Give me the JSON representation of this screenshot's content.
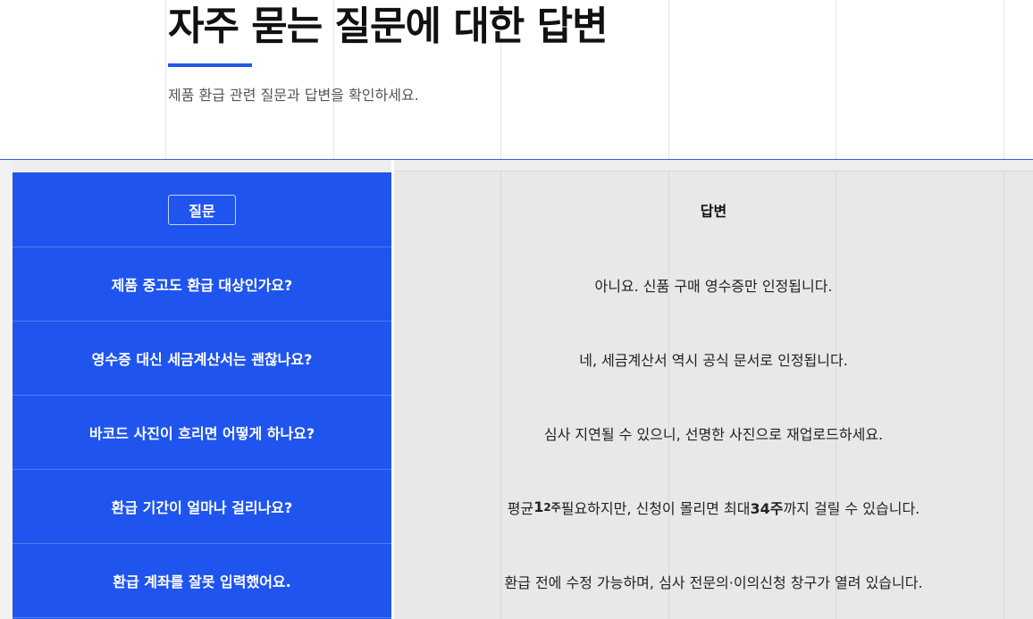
{
  "page": {
    "title": "자주 묻는 질문에 대한 답변",
    "subtitle": "제품 환급 관련 질문과 답변을 확인하세요."
  },
  "table": {
    "question_header": "질문",
    "answer_header": "답변",
    "rows": [
      {
        "question": "제품 중고도 환급 대상인가요?",
        "answer": "아니요. 신품 구매 영수증만 인정됩니다."
      },
      {
        "question": "영수증 대신 세금계산서는 괜찮나요?",
        "answer": "네, 세금계산서 역시 공식 문서로 인정됩니다."
      },
      {
        "question": "바코드 사진이 흐리면 어떻게 하나요?",
        "answer": "심사 지연될 수 있으니, 선명한 사진으로 재업로드하세요."
      },
      {
        "question": "환급 기간이 얼마나 걸리나요?",
        "answer_parts": {
          "a": "평균 ",
          "b": "1",
          "c": "2주",
          "d": " 필요하지만, 신청이 몰리면 최대 ",
          "e": "34주",
          "f": "까지 걸릴 수 있습니다."
        }
      },
      {
        "question": "환급 계좌를 잘못 입력했어요.",
        "answer": "환급 전에 수정 가능하며, 심사 전문의·이의신청 창구가 열려 있습니다."
      }
    ]
  },
  "colors": {
    "accent": "#1f57e6",
    "question_column": "#1f55ee",
    "answer_column": "#e8e8e8"
  }
}
